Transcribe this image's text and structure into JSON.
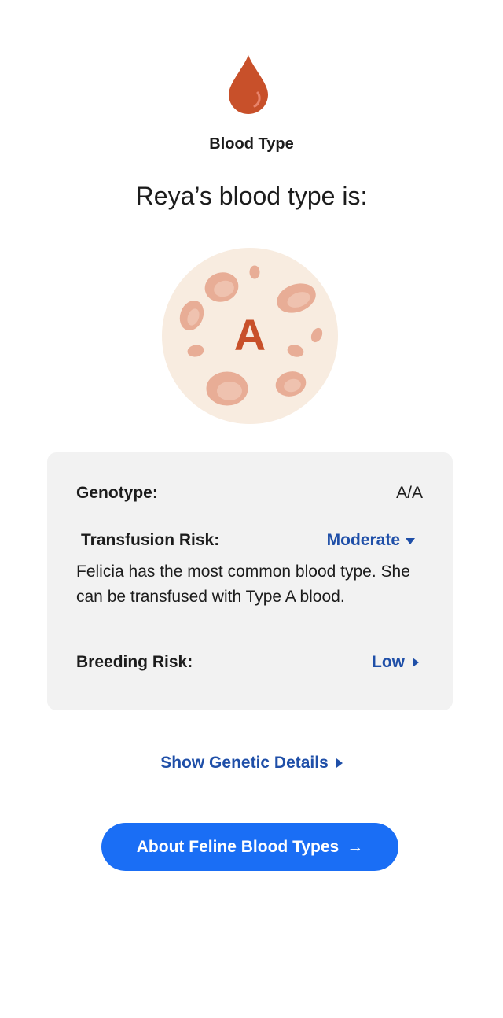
{
  "header": {
    "icon": "blood-drop-icon",
    "section_label": "Blood Type",
    "headline": "Reya’s blood type is:"
  },
  "blood_type": {
    "letter": "A",
    "illustration": "blood-cells-illustration"
  },
  "details": {
    "genotype_label": "Genotype:",
    "genotype_value": "A/A",
    "transfusion_label": "Transfusion Risk:",
    "transfusion_value": "Moderate",
    "transfusion_description": "Felicia has the most common blood type. She can be transfused with Type A blood.",
    "breeding_label": "Breeding Risk:",
    "breeding_value": "Low"
  },
  "genetic_details_link": "Show Genetic Details",
  "about_button": {
    "label": "About Feline Blood Types",
    "icon": "→"
  },
  "colors": {
    "accent_blue": "#1a6ef5",
    "link_blue": "#1f4fa8",
    "blood_red": "#c8502a",
    "circle_bg": "#f8ece0",
    "cell_fill": "#e8ad96",
    "card_bg": "#f2f2f2"
  }
}
